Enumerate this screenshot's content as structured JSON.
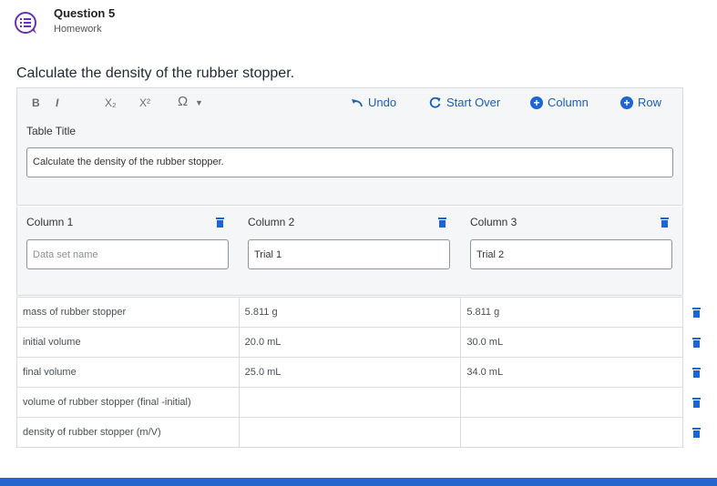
{
  "question": {
    "title": "Question 5",
    "subtitle": "Homework",
    "icon": "question-list-icon"
  },
  "prompt": "Calculate the density of the rubber stopper.",
  "toolbar": {
    "bold": "B",
    "italic": "I",
    "subscript": "X₂",
    "superscript": "X²",
    "special_chars": "Ω",
    "undo": "Undo",
    "start_over": "Start Over",
    "add_column": "Column",
    "add_row": "Row"
  },
  "table_title": {
    "label": "Table Title",
    "value": "Calculate the density of the rubber stopper."
  },
  "columns": [
    {
      "label": "Column 1",
      "value": "",
      "placeholder": "Data set name"
    },
    {
      "label": "Column 2",
      "value": "Trial 1",
      "placeholder": ""
    },
    {
      "label": "Column 3",
      "value": "Trial 2",
      "placeholder": ""
    }
  ],
  "rows": [
    {
      "c1": "mass of rubber stopper",
      "c2": "5.811 g",
      "c3": "5.811 g"
    },
    {
      "c1": "initial volume",
      "c2": "20.0 mL",
      "c3": "30.0 mL"
    },
    {
      "c1": "final volume",
      "c2": "25.0 mL",
      "c3": "34.0 mL"
    },
    {
      "c1": "volume of rubber stopper (final -initial)",
      "c2": "",
      "c3": ""
    },
    {
      "c1": "density of rubber stopper (m/V)",
      "c2": "",
      "c3": ""
    }
  ],
  "colors": {
    "accent": "#1a66d6",
    "link": "#1a5fb4",
    "icon_purple": "#6b2fb3",
    "bottom_bar": "#2466cc"
  }
}
